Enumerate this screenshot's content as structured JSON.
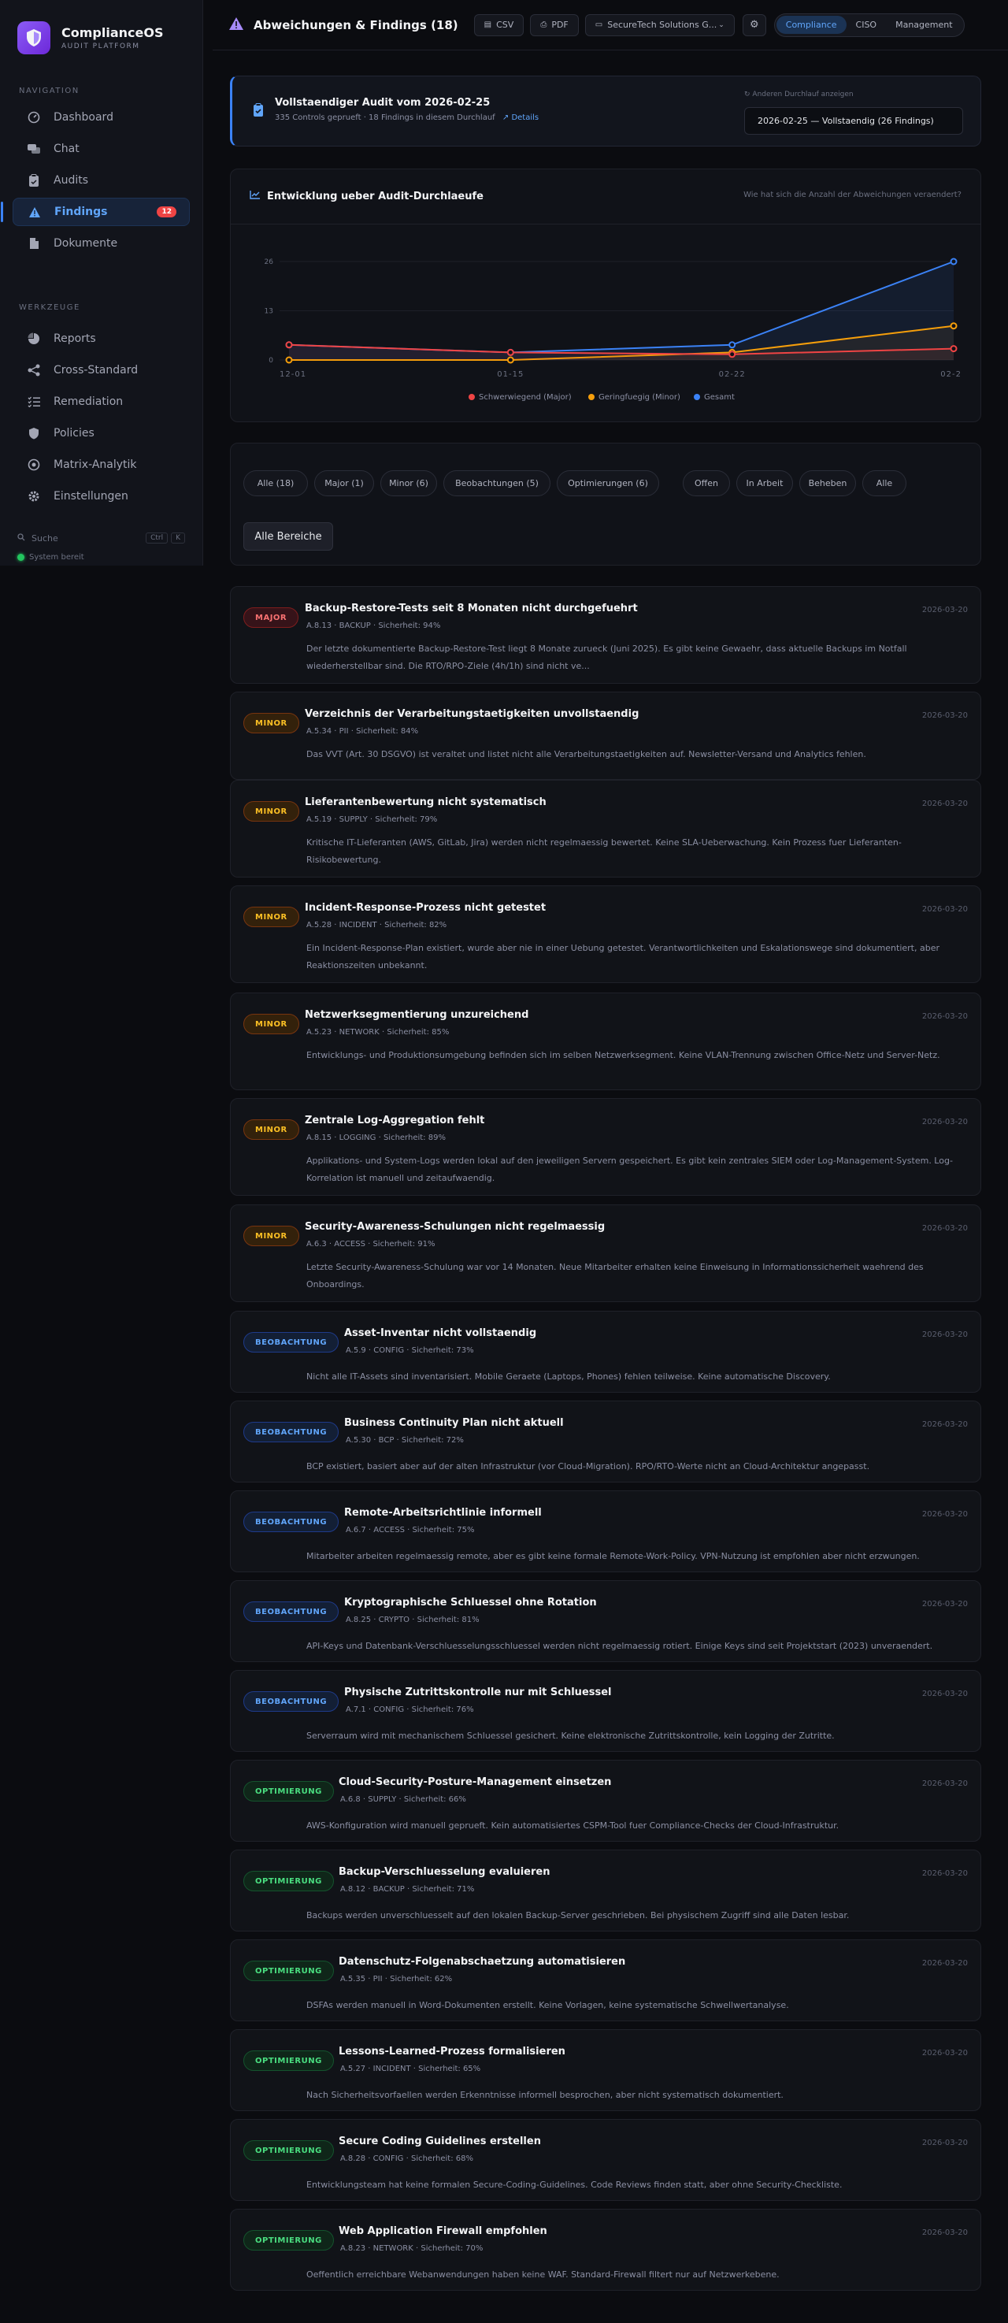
{
  "brand": {
    "name": "ComplianceOS",
    "sub": "AUDIT PLATFORM"
  },
  "sidebar": {
    "nav_label": "NAVIGATION",
    "nav": [
      {
        "label": "Dashboard",
        "icon": "dashboard-icon"
      },
      {
        "label": "Chat",
        "icon": "chat-icon"
      },
      {
        "label": "Audits",
        "icon": "clipboard-icon"
      },
      {
        "label": "Findings",
        "icon": "warning-icon",
        "badge": "12",
        "active": true
      },
      {
        "label": "Dokumente",
        "icon": "document-icon"
      }
    ],
    "tools_label": "WERKZEUGE",
    "tools": [
      {
        "label": "Reports",
        "icon": "pie-icon"
      },
      {
        "label": "Cross-Standard",
        "icon": "share-icon"
      },
      {
        "label": "Remediation",
        "icon": "list-icon"
      },
      {
        "label": "Policies",
        "icon": "shield-icon"
      },
      {
        "label": "Matrix-Analytik",
        "icon": "grid-icon"
      },
      {
        "label": "Einstellungen",
        "icon": "gear-icon"
      }
    ],
    "search": "Suche",
    "kbd1": "Ctrl",
    "kbd2": "K",
    "status": "System bereit"
  },
  "header": {
    "title": "Abweichungen & Findings (18)",
    "csv": "CSV",
    "pdf": "PDF",
    "org": "SecureTech Solutions G...",
    "views": [
      "Compliance",
      "CISO",
      "Management"
    ],
    "active_view": "Compliance"
  },
  "audit": {
    "title": "Vollstaendiger Audit vom 2026-02-25",
    "sub": "335 Controls geprueft · 18 Findings in diesem Durchlauf",
    "details": "Details",
    "select_label": "Anderen Durchlauf anzeigen",
    "selected": "2026-02-25 — Vollstaendig (26 Findings)"
  },
  "chart_section": {
    "title": "Entwicklung ueber Audit-Durchlaeufe",
    "hint": "Wie hat sich die Anzahl der Abweichungen veraendert?"
  },
  "chart_data": {
    "type": "line",
    "x": [
      "12-01",
      "01-15",
      "02-22",
      "02-2"
    ],
    "ylim": [
      0,
      26
    ],
    "yticks": [
      0,
      13,
      26
    ],
    "series": [
      {
        "name": "Schwerwiegend (Major)",
        "color": "#ef4444",
        "values": [
          4,
          2,
          1.5,
          3
        ]
      },
      {
        "name": "Geringfuegig (Minor)",
        "color": "#f59e0b",
        "values": [
          0,
          0,
          2,
          9
        ]
      },
      {
        "name": "Gesamt",
        "color": "#3b82f6",
        "values": [
          4,
          2,
          4,
          26
        ]
      }
    ]
  },
  "filters": {
    "types": [
      "Alle (18)",
      "Major (1)",
      "Minor (6)",
      "Beobachtungen (5)",
      "Optimierungen (6)"
    ],
    "status": [
      "Offen",
      "In Arbeit",
      "Beheben",
      "Alle"
    ],
    "area": "Alle Bereiche"
  },
  "findings": [
    {
      "type": "major",
      "badge": "MAJOR",
      "title": "Backup-Restore-Tests seit 8 Monaten nicht durchgefuehrt",
      "meta": "A.8.13 · BACKUP · Sicherheit: 94%",
      "date": "2026-03-20",
      "desc": "Der letzte dokumentierte Backup-Restore-Test liegt 8 Monate zurueck (Juni 2025). Es gibt keine Gewaehr, dass aktuelle Backups im Notfall wiederherstellbar sind. Die RTO/RPO-Ziele (4h/1h) sind nicht ve..."
    },
    {
      "type": "minor",
      "badge": "MINOR",
      "title": "Verzeichnis der Verarbeitungstaetigkeiten unvollstaendig",
      "meta": "A.5.34 · PII · Sicherheit: 84%",
      "date": "2026-03-20",
      "desc": "Das VVT (Art. 30 DSGVO) ist veraltet und listet nicht alle Verarbeitungstaetigkeiten auf. Newsletter-Versand und Analytics fehlen."
    },
    {
      "type": "minor",
      "badge": "MINOR",
      "title": "Lieferantenbewertung nicht systematisch",
      "meta": "A.5.19 · SUPPLY · Sicherheit: 79%",
      "date": "2026-03-20",
      "desc": "Kritische IT-Lieferanten (AWS, GitLab, Jira) werden nicht regelmaessig bewertet. Keine SLA-Ueberwachung. Kein Prozess fuer Lieferanten-Risikobewertung."
    },
    {
      "type": "minor",
      "badge": "MINOR",
      "title": "Incident-Response-Prozess nicht getestet",
      "meta": "A.5.28 · INCIDENT · Sicherheit: 82%",
      "date": "2026-03-20",
      "desc": "Ein Incident-Response-Plan existiert, wurde aber nie in einer Uebung getestet. Verantwortlichkeiten und Eskalationswege sind dokumentiert, aber Reaktionszeiten unbekannt."
    },
    {
      "type": "minor",
      "badge": "MINOR",
      "title": "Netzwerksegmentierung unzureichend",
      "meta": "A.5.23 · NETWORK · Sicherheit: 85%",
      "date": "2026-03-20",
      "desc": "Entwicklungs- und Produktionsumgebung befinden sich im selben Netzwerksegment. Keine VLAN-Trennung zwischen Office-Netz und Server-Netz."
    },
    {
      "type": "minor",
      "badge": "MINOR",
      "title": "Zentrale Log-Aggregation fehlt",
      "meta": "A.8.15 · LOGGING · Sicherheit: 89%",
      "date": "2026-03-20",
      "desc": "Applikations- und System-Logs werden lokal auf den jeweiligen Servern gespeichert. Es gibt kein zentrales SIEM oder Log-Management-System. Log-Korrelation ist manuell und zeitaufwaendig."
    },
    {
      "type": "minor",
      "badge": "MINOR",
      "title": "Security-Awareness-Schulungen nicht regelmaessig",
      "meta": "A.6.3 · ACCESS · Sicherheit: 91%",
      "date": "2026-03-20",
      "desc": "Letzte Security-Awareness-Schulung war vor 14 Monaten. Neue Mitarbeiter erhalten keine Einweisung in Informationssicherheit waehrend des Onboardings."
    },
    {
      "type": "beob",
      "badge": "BEOBACHTUNG",
      "title": "Asset-Inventar nicht vollstaendig",
      "meta": "A.5.9 · CONFIG · Sicherheit: 73%",
      "date": "2026-03-20",
      "desc": "Nicht alle IT-Assets sind inventarisiert. Mobile Geraete (Laptops, Phones) fehlen teilweise. Keine automatische Discovery."
    },
    {
      "type": "beob",
      "badge": "BEOBACHTUNG",
      "title": "Business Continuity Plan nicht aktuell",
      "meta": "A.5.30 · BCP · Sicherheit: 72%",
      "date": "2026-03-20",
      "desc": "BCP existiert, basiert aber auf der alten Infrastruktur (vor Cloud-Migration). RPO/RTO-Werte nicht an Cloud-Architektur angepasst."
    },
    {
      "type": "beob",
      "badge": "BEOBACHTUNG",
      "title": "Remote-Arbeitsrichtlinie informell",
      "meta": "A.6.7 · ACCESS · Sicherheit: 75%",
      "date": "2026-03-20",
      "desc": "Mitarbeiter arbeiten regelmaessig remote, aber es gibt keine formale Remote-Work-Policy. VPN-Nutzung ist empfohlen aber nicht erzwungen."
    },
    {
      "type": "beob",
      "badge": "BEOBACHTUNG",
      "title": "Kryptographische Schluessel ohne Rotation",
      "meta": "A.8.25 · CRYPTO · Sicherheit: 81%",
      "date": "2026-03-20",
      "desc": "API-Keys und Datenbank-Verschluesselungsschluessel werden nicht regelmaessig rotiert. Einige Keys sind seit Projektstart (2023) unveraendert."
    },
    {
      "type": "beob",
      "badge": "BEOBACHTUNG",
      "title": "Physische Zutrittskontrolle nur mit Schluessel",
      "meta": "A.7.1 · CONFIG · Sicherheit: 76%",
      "date": "2026-03-20",
      "desc": "Serverraum wird mit mechanischem Schluessel gesichert. Keine elektronische Zutrittskontrolle, kein Logging der Zutritte."
    },
    {
      "type": "opt",
      "badge": "OPTIMIERUNG",
      "title": "Cloud-Security-Posture-Management einsetzen",
      "meta": "A.6.8 · SUPPLY · Sicherheit: 66%",
      "date": "2026-03-20",
      "desc": "AWS-Konfiguration wird manuell geprueft. Kein automatisiertes CSPM-Tool fuer Compliance-Checks der Cloud-Infrastruktur."
    },
    {
      "type": "opt",
      "badge": "OPTIMIERUNG",
      "title": "Backup-Verschluesselung evaluieren",
      "meta": "A.8.12 · BACKUP · Sicherheit: 71%",
      "date": "2026-03-20",
      "desc": "Backups werden unverschluesselt auf den lokalen Backup-Server geschrieben. Bei physischem Zugriff sind alle Daten lesbar."
    },
    {
      "type": "opt",
      "badge": "OPTIMIERUNG",
      "title": "Datenschutz-Folgenabschaetzung automatisieren",
      "meta": "A.5.35 · PII · Sicherheit: 62%",
      "date": "2026-03-20",
      "desc": "DSFAs werden manuell in Word-Dokumenten erstellt. Keine Vorlagen, keine systematische Schwellwertanalyse."
    },
    {
      "type": "opt",
      "badge": "OPTIMIERUNG",
      "title": "Lessons-Learned-Prozess formalisieren",
      "meta": "A.5.27 · INCIDENT · Sicherheit: 65%",
      "date": "2026-03-20",
      "desc": "Nach Sicherheitsvorfaellen werden Erkenntnisse informell besprochen, aber nicht systematisch dokumentiert."
    },
    {
      "type": "opt",
      "badge": "OPTIMIERUNG",
      "title": "Secure Coding Guidelines erstellen",
      "meta": "A.8.28 · CONFIG · Sicherheit: 68%",
      "date": "2026-03-20",
      "desc": "Entwicklungsteam hat keine formalen Secure-Coding-Guidelines. Code Reviews finden statt, aber ohne Security-Checkliste."
    },
    {
      "type": "opt",
      "badge": "OPTIMIERUNG",
      "title": "Web Application Firewall empfohlen",
      "meta": "A.8.23 · NETWORK · Sicherheit: 70%",
      "date": "2026-03-20",
      "desc": "Oeffentlich erreichbare Webanwendungen haben keine WAF. Standard-Firewall filtert nur auf Netzwerkebene."
    }
  ]
}
